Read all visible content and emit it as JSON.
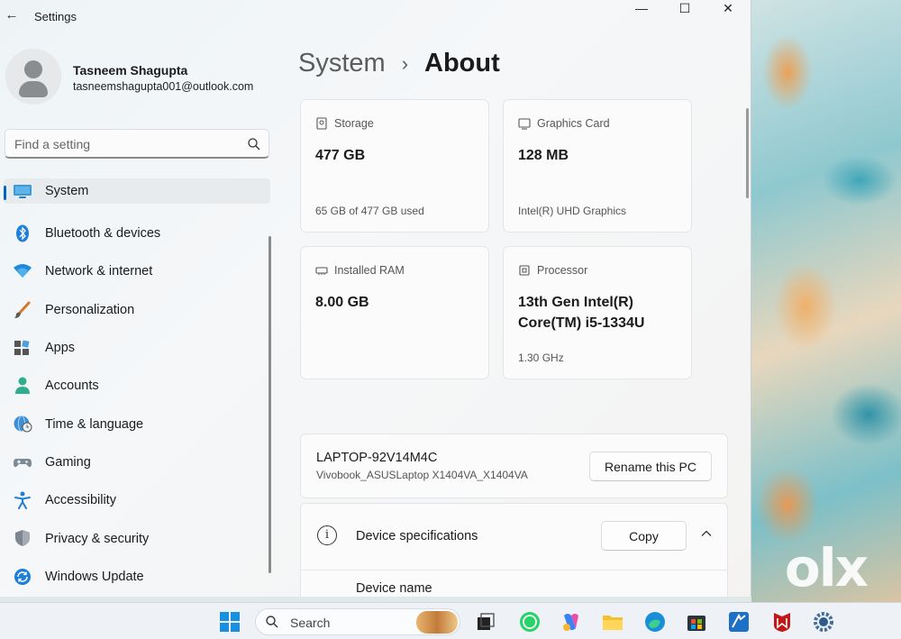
{
  "window": {
    "app_title": "Settings",
    "controls": {
      "minimize": "—",
      "maximize": "☐",
      "close": "✕"
    }
  },
  "profile": {
    "name": "Tasneem Shagupta",
    "email": "tasneemshagupta001@outlook.com"
  },
  "search": {
    "placeholder": "Find a setting"
  },
  "nav": {
    "items": [
      {
        "label": "System",
        "icon": "monitor-icon",
        "active": true
      },
      {
        "label": "Bluetooth & devices",
        "icon": "bluetooth-icon"
      },
      {
        "label": "Network & internet",
        "icon": "wifi-icon"
      },
      {
        "label": "Personalization",
        "icon": "brush-icon"
      },
      {
        "label": "Apps",
        "icon": "apps-icon"
      },
      {
        "label": "Accounts",
        "icon": "person-icon"
      },
      {
        "label": "Time & language",
        "icon": "globe-clock-icon"
      },
      {
        "label": "Gaming",
        "icon": "gamepad-icon"
      },
      {
        "label": "Accessibility",
        "icon": "accessibility-icon"
      },
      {
        "label": "Privacy & security",
        "icon": "shield-icon"
      },
      {
        "label": "Windows Update",
        "icon": "sync-icon"
      }
    ]
  },
  "header": {
    "parent": "System",
    "separator": "›",
    "current": "About"
  },
  "cards": {
    "storage": {
      "label": "Storage",
      "value": "477 GB",
      "sub": "65 GB of 477 GB used"
    },
    "graphics": {
      "label": "Graphics Card",
      "value": "128 MB",
      "sub": "Intel(R) UHD Graphics"
    },
    "ram": {
      "label": "Installed RAM",
      "value": "8.00 GB"
    },
    "processor": {
      "label": "Processor",
      "value_line1": "13th Gen Intel(R)",
      "value_line2": "Core(TM) i5-1334U",
      "sub": "1.30 GHz"
    }
  },
  "pc": {
    "name": "LAPTOP-92V14M4C",
    "model": "Vivobook_ASUSLaptop X1404VA_X1404VA",
    "rename_button": "Rename this PC"
  },
  "specs": {
    "title": "Device specifications",
    "copy_button": "Copy",
    "first_row_label": "Device name"
  },
  "taskbar": {
    "search_label": "Search",
    "icons": [
      "windows-start-icon",
      "search-icon",
      "task-view-icon",
      "whatsapp-icon",
      "copilot-icon",
      "file-explorer-icon",
      "edge-icon",
      "store-icon",
      "app-icon",
      "mcafee-icon",
      "settings-icon"
    ]
  },
  "watermark": "olx"
}
